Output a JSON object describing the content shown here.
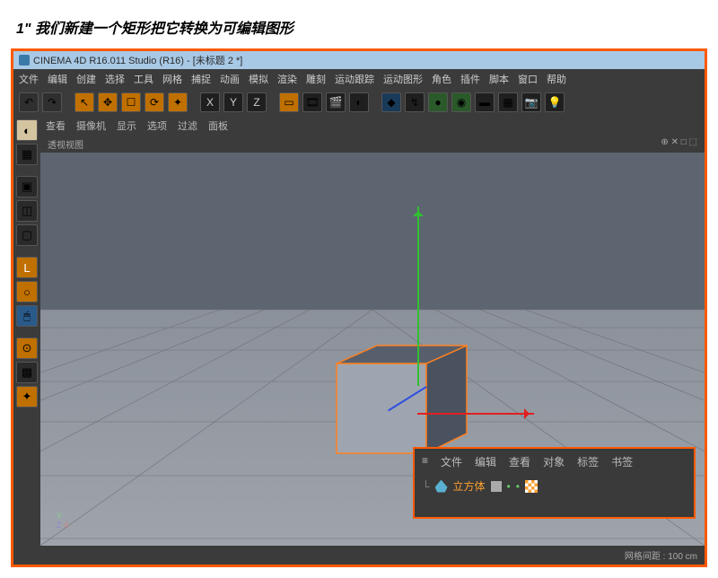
{
  "caption": "1\" 我们新建一个矩形把它转换为可编辑图形",
  "titlebar": {
    "text": "CINEMA 4D R16.011 Studio (R16) - [未标题 2 *]"
  },
  "menubar": [
    "文件",
    "编辑",
    "创建",
    "选择",
    "工具",
    "网格",
    "捕捉",
    "动画",
    "模拟",
    "渲染",
    "雕刻",
    "运动跟踪",
    "运动图形",
    "角色",
    "插件",
    "脚本",
    "窗口",
    "帮助"
  ],
  "toolbar_icons": [
    "undo",
    "redo",
    "",
    "select",
    "move",
    "scale",
    "rotate",
    "recent",
    "",
    "axis-x",
    "axis-y",
    "axis-z",
    "",
    "cube-prim",
    "film",
    "clapper",
    "spot",
    "",
    "render",
    "render-set",
    "sphere",
    "globe",
    "floor",
    "grid-icon",
    "camera",
    "light"
  ],
  "left_tools": [
    "live",
    "mat",
    "",
    "poly",
    "edge",
    "point",
    "",
    "lathe",
    "spline",
    "mouse",
    "",
    "magnet",
    "check",
    "axis-s"
  ],
  "view_menu": [
    "查看",
    "摄像机",
    "显示",
    "选项",
    "过滤",
    "面板"
  ],
  "view_hud": {
    "left": "透视视图",
    "right": "⊕ ✕ □ ⬚"
  },
  "compass": {
    "y": "Y",
    "x": "X",
    "z": "Z"
  },
  "panel": {
    "menu": [
      "≡",
      "文件",
      "编辑",
      "查看",
      "对象",
      "标签",
      "书签"
    ],
    "object": {
      "name": "立方体"
    }
  },
  "statusbar": {
    "text": "网格间距 : 100 cm"
  }
}
